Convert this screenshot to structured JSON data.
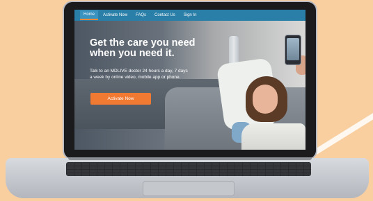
{
  "nav": {
    "items": [
      {
        "label": "Home",
        "active": true
      },
      {
        "label": "Activate Now",
        "active": false
      },
      {
        "label": "FAQs",
        "active": false
      },
      {
        "label": "Contact Us",
        "active": false
      },
      {
        "label": "Sign In",
        "active": false
      }
    ]
  },
  "hero": {
    "headline_line1": "Get the care you need",
    "headline_line2": "when you need it.",
    "subtext_line1": "Talk to an MDLIVE doctor 24 hours a day, 7 days",
    "subtext_line2": "a week by online video, mobile app or phone.",
    "cta_label": "Activate Now"
  },
  "colors": {
    "background": "#f9cfa0",
    "nav_bar": "#2a7fa8",
    "cta": "#f07a32",
    "active_tab_accent": "#f28a3a"
  },
  "images": {
    "hero_photo": "child-on-couch-video-call-illustration"
  }
}
